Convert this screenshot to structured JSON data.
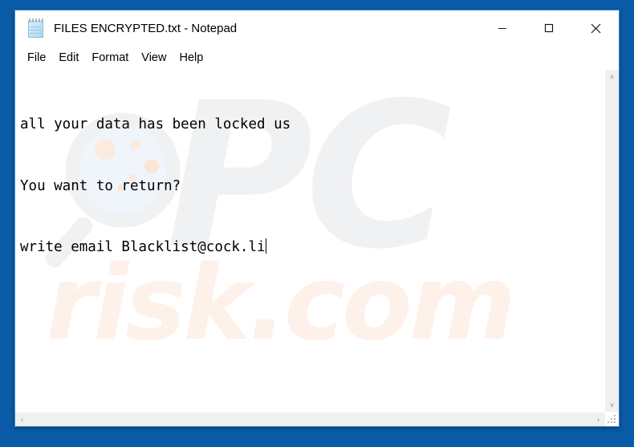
{
  "window": {
    "title": "FILES ENCRYPTED.txt - Notepad",
    "icon": "notepad-icon",
    "border_color": "#3a8ad0",
    "background": "#ffffff"
  },
  "desktop": {
    "background_color": "#0a5ca8"
  },
  "controls": {
    "minimize": "minimize-icon",
    "maximize": "maximize-icon",
    "close": "close-icon"
  },
  "menu": {
    "items": [
      {
        "label": "File"
      },
      {
        "label": "Edit"
      },
      {
        "label": "Format"
      },
      {
        "label": "View"
      },
      {
        "label": "Help"
      }
    ]
  },
  "document": {
    "lines": [
      "all your data has been locked us",
      "You want to return?",
      "write email Blacklist@cock.li"
    ],
    "caret_after_line": 3,
    "text_color": "#000000"
  },
  "watermark": {
    "brand_top": "PC",
    "brand_bottom": "risk.com",
    "glass_icon": "magnifying-glass-icon",
    "gray_color": "#f0f1f2",
    "peach_color": "#fdf1e9"
  },
  "scrollbars": {
    "vertical_up": "˄",
    "vertical_down": "˅",
    "horizontal_left": "‹",
    "horizontal_right": "›",
    "track_color": "#f0f0f0"
  }
}
